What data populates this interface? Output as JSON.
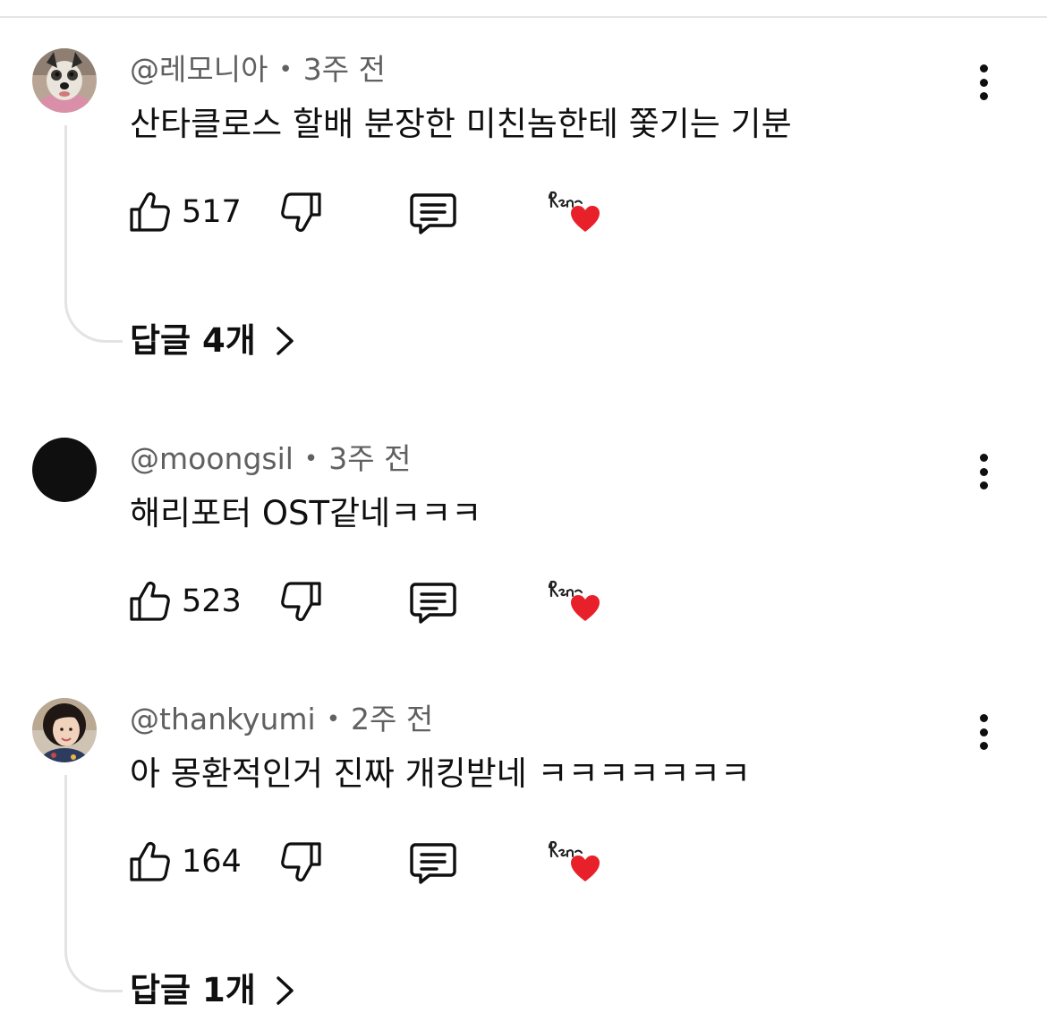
{
  "comments": [
    {
      "author": "@레모니아",
      "time": "3주 전",
      "text": "산타클로스 할배 분장한 미친놈한테 쫓기는 기분",
      "likes": "517",
      "replies_label": "답글 4개",
      "avatar": "dog-photo"
    },
    {
      "author": "@moongsil",
      "time": "3주 전",
      "text": "해리포터 OST같네ㅋㅋㅋ",
      "likes": "523",
      "avatar": "black-circle"
    },
    {
      "author": "@thankyumi",
      "time": "2주 전",
      "text": "아 몽환적인거 진짜 개킹받네 ㅋㅋㅋㅋㅋㅋㅋ",
      "likes": "164",
      "replies_label": "답글 1개",
      "avatar": "woman-photo"
    }
  ],
  "icons": {
    "like": "thumbs-up-icon",
    "dislike": "thumbs-down-icon",
    "reply": "comment-icon",
    "creator_heart": "creator-heart-badge",
    "more": "more-vertical-icon",
    "chevron": "chevron-right-icon"
  },
  "colors": {
    "heart": "#e8202a",
    "meta": "#606060",
    "text": "#0f0f0f"
  }
}
